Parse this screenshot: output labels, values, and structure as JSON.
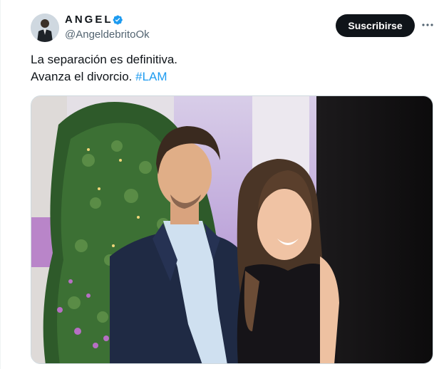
{
  "tweet": {
    "author_name": "ANGEL",
    "handle": "@AngeldebritoOk",
    "subscribe_label": "Suscribirse",
    "text_line1": "La separación es definitiva.",
    "text_line2": "Avanza el divorcio.",
    "hashtag": "#LAM"
  },
  "icons": {
    "verified": "verified-badge-icon",
    "more": "more-horizontal-icon"
  },
  "colors": {
    "accent": "#1d9bf0",
    "button_bg": "#0f1419",
    "secondary_text": "#536471"
  }
}
